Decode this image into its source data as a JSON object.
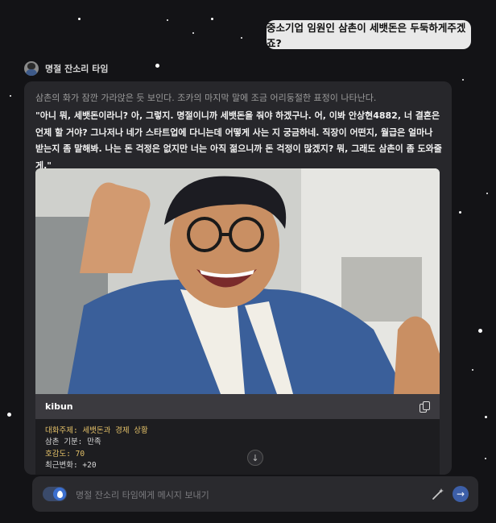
{
  "user_message": "중소기업 임원인 삼촌이 세뱃돈은 두둑하게주겠죠?",
  "bot": {
    "name": "명절 잔소리 타임",
    "narration": "삼촌의 화가 잠깐 가라앉은 듯 보인다. 조카의 마지막 말에 조금 어리둥절한 표정이 나타난다.",
    "dialogue": "\"아니 뭐, 세뱃돈이라니? 아, 그렇지. 명절이니까 세뱃돈을 줘야 하겠구나. 어, 이봐 안상현4882, 너 결혼은 언제 할 거야? 그나저나 네가 스타트업에 다니는데 어떻게 사는 지 궁금하네. 직장이 어떤지, 월급은 얼마나 받는지 좀 말해봐. 나는 돈 걱정은 없지만 너는 아직 젊으니까 돈 걱정이 많겠지? 뭐, 그래도 삼촌이 좀 도와줄게.\""
  },
  "image_caption": "kibun",
  "stats": [
    {
      "text": "대화주제: 세뱃돈과 경제 상황",
      "color": "#e3c068"
    },
    {
      "text": "삼촌 기분: 만족",
      "color": "#d8d8d8"
    },
    {
      "text": "호감도: 70",
      "color": "#e3c068"
    },
    {
      "text": "최근변화: +20",
      "color": "#d8d8d8"
    }
  ],
  "composer": {
    "placeholder": "명절 잔소리 타임에게 메시지 보내기"
  },
  "icons": {
    "copy": "copy-icon",
    "scroll_down": "arrow-down-icon",
    "toggle": "water-drop-icon",
    "magic": "magic-wand-icon",
    "send": "arrow-right-icon"
  },
  "colors": {
    "background": "#131316",
    "card": "#27272b",
    "accent": "#3d5fa8",
    "stat_highlight": "#e3c068"
  }
}
